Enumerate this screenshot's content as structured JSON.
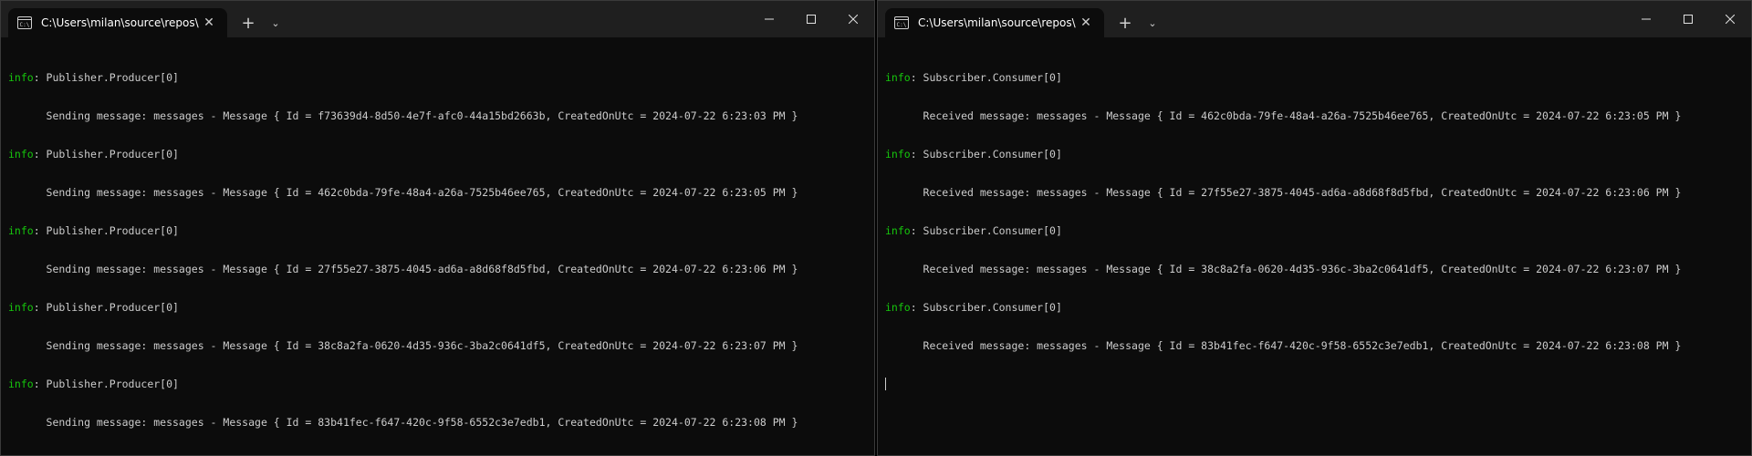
{
  "left_window": {
    "tab_title": "C:\\Users\\milan\\source\\repos\\",
    "lines": [
      {
        "level": "info",
        "text": ": Publisher.Producer[0]"
      },
      {
        "level": "",
        "text": "      Sending message: messages - Message { Id = f73639d4-8d50-4e7f-afc0-44a15bd2663b, CreatedOnUtc = 2024-07-22 6:23:03 PM }"
      },
      {
        "level": "info",
        "text": ": Publisher.Producer[0]"
      },
      {
        "level": "",
        "text": "      Sending message: messages - Message { Id = 462c0bda-79fe-48a4-a26a-7525b46ee765, CreatedOnUtc = 2024-07-22 6:23:05 PM }"
      },
      {
        "level": "info",
        "text": ": Publisher.Producer[0]"
      },
      {
        "level": "",
        "text": "      Sending message: messages - Message { Id = 27f55e27-3875-4045-ad6a-a8d68f8d5fbd, CreatedOnUtc = 2024-07-22 6:23:06 PM }"
      },
      {
        "level": "info",
        "text": ": Publisher.Producer[0]"
      },
      {
        "level": "",
        "text": "      Sending message: messages - Message { Id = 38c8a2fa-0620-4d35-936c-3ba2c0641df5, CreatedOnUtc = 2024-07-22 6:23:07 PM }"
      },
      {
        "level": "info",
        "text": ": Publisher.Producer[0]"
      },
      {
        "level": "",
        "text": "      Sending message: messages - Message { Id = 83b41fec-f647-420c-9f58-6552c3e7edb1, CreatedOnUtc = 2024-07-22 6:23:08 PM }"
      }
    ]
  },
  "right_window": {
    "tab_title": "C:\\Users\\milan\\source\\repos\\",
    "lines": [
      {
        "level": "info",
        "text": ": Subscriber.Consumer[0]"
      },
      {
        "level": "",
        "text": "      Received message: messages - Message { Id = 462c0bda-79fe-48a4-a26a-7525b46ee765, CreatedOnUtc = 2024-07-22 6:23:05 PM }"
      },
      {
        "level": "info",
        "text": ": Subscriber.Consumer[0]"
      },
      {
        "level": "",
        "text": "      Received message: messages - Message { Id = 27f55e27-3875-4045-ad6a-a8d68f8d5fbd, CreatedOnUtc = 2024-07-22 6:23:06 PM }"
      },
      {
        "level": "info",
        "text": ": Subscriber.Consumer[0]"
      },
      {
        "level": "",
        "text": "      Received message: messages - Message { Id = 38c8a2fa-0620-4d35-936c-3ba2c0641df5, CreatedOnUtc = 2024-07-22 6:23:07 PM }"
      },
      {
        "level": "info",
        "text": ": Subscriber.Consumer[0]"
      },
      {
        "level": "",
        "text": "      Received message: messages - Message { Id = 83b41fec-f647-420c-9f58-6552c3e7edb1, CreatedOnUtc = 2024-07-22 6:23:08 PM }"
      }
    ]
  },
  "ui": {
    "new_tab_label": "+",
    "dropdown_label": "⌄",
    "close_label": "✕",
    "icons": [
      "terminal-icon",
      "close-icon",
      "plus-icon",
      "chevron-down-icon",
      "minimize-icon",
      "maximize-icon",
      "window-close-icon"
    ]
  },
  "colors": {
    "background": "#0c0c0c",
    "titlebar": "#1f1f1f",
    "log_level": "#16c60c",
    "text": "#cccccc"
  }
}
